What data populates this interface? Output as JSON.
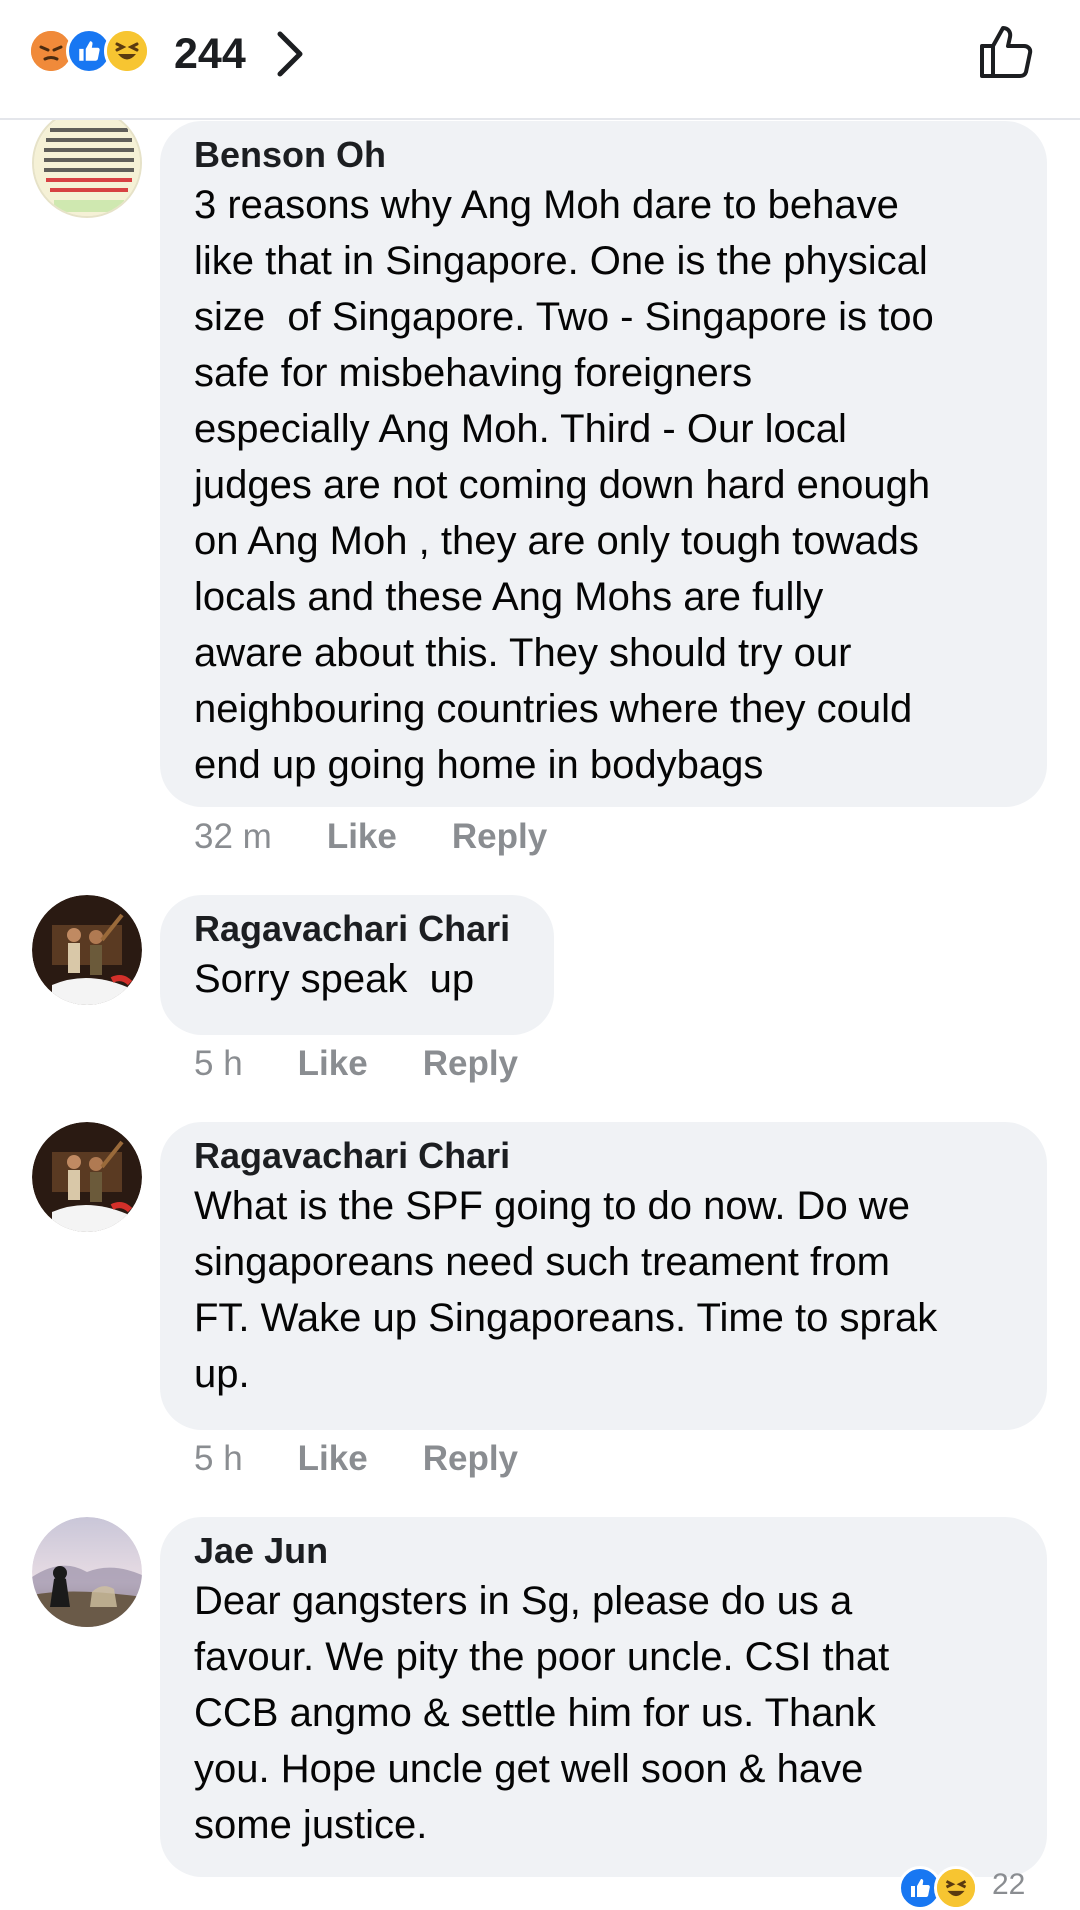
{
  "header": {
    "reaction_count": "244",
    "reactions": [
      "angry-icon",
      "like-icon",
      "haha-icon"
    ]
  },
  "comments": [
    {
      "author": "Benson Oh",
      "text": "3 reasons why Ang Moh dare to behave\nlike that in Singapore. One is the physical\nsize  of Singapore. Two - Singapore is too\nsafe for misbehaving foreigners\nespecially Ang Moh. Third - Our local\njudges are not coming down hard enough\non Ang Moh , they are only tough towads\nlocals and these Ang Mohs are fully\naware about this. They should try our\nneighbouring countries where they could\nend up going home in bodybags",
      "time": "32 m",
      "like_label": "Like",
      "reply_label": "Reply"
    },
    {
      "author": "Ragavachari Chari",
      "text": "Sorry speak  up",
      "time": "5 h",
      "like_label": "Like",
      "reply_label": "Reply"
    },
    {
      "author": "Ragavachari Chari",
      "text": "What is the SPF going to do now. Do we\nsingaporeans need such treament from\nFT. Wake up Singaporeans. Time to sprak\nup.",
      "time": "5 h",
      "like_label": "Like",
      "reply_label": "Reply"
    },
    {
      "author": "Jae Jun",
      "text": "Dear gangsters in Sg, please do us a\nfavour. We pity the poor uncle. CSI that\nCCB angmo & settle him for us. Thank\nyou. Hope uncle get well soon & have\nsome justice.",
      "reaction_count": "22"
    }
  ],
  "colors": {
    "bubble": "#f0f2f5",
    "meta": "#8a8d91",
    "like_blue": "#1877f2",
    "angry": "#f0634a",
    "haha": "#f7c531"
  }
}
